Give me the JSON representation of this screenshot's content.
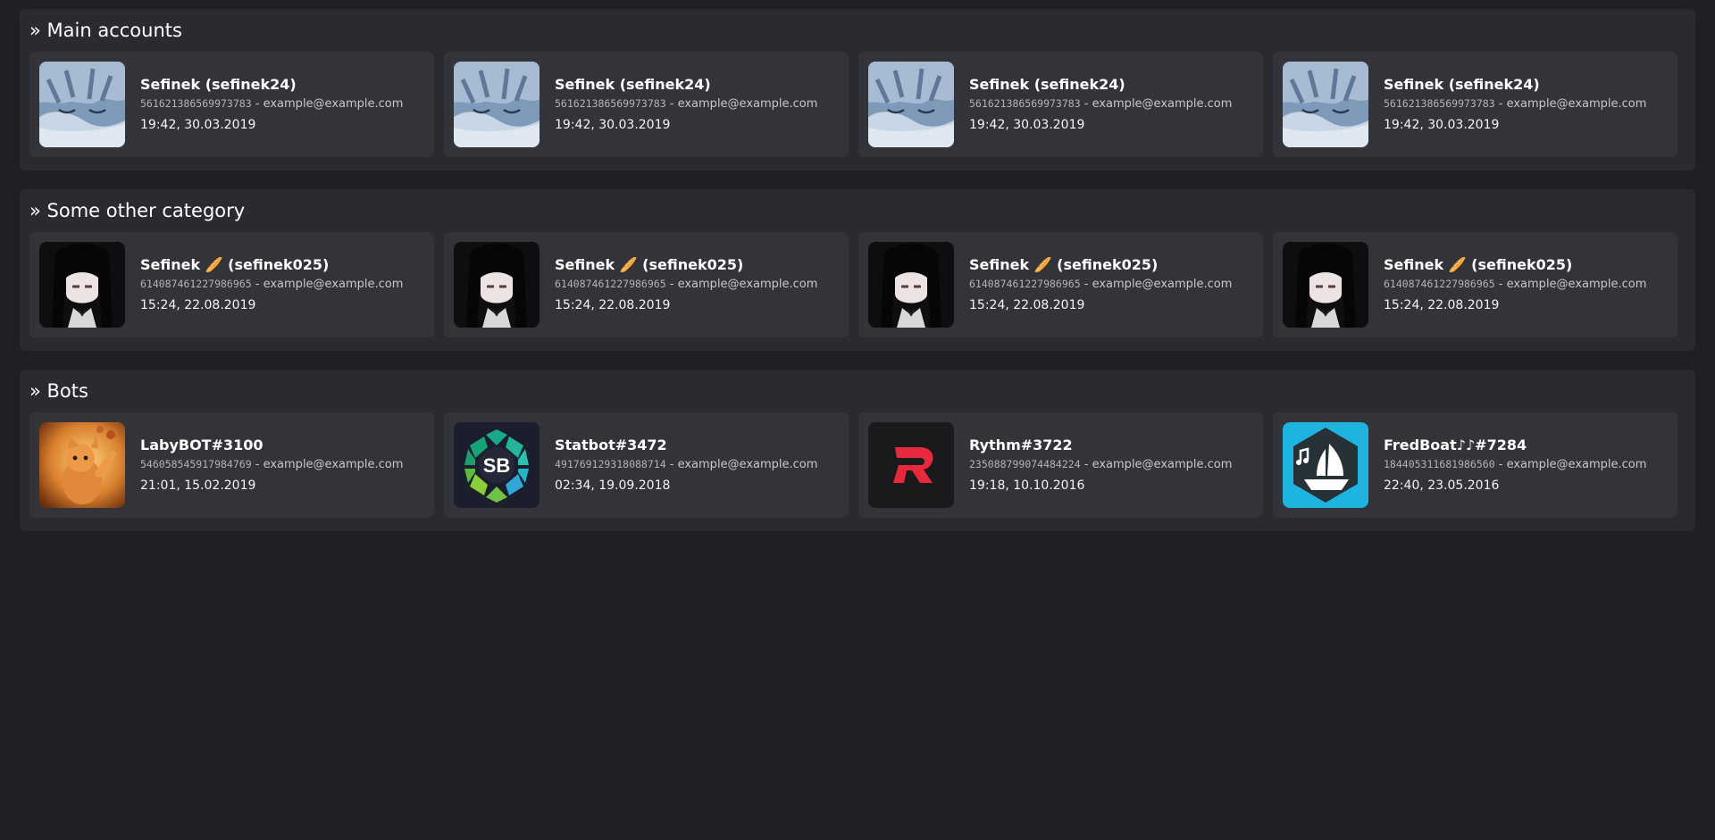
{
  "sections": [
    {
      "title": "» Main accounts",
      "cards": [
        {
          "name": "Sefinek (sefinek24)",
          "id": "561621386569973783",
          "email": "example@example.com",
          "date": "19:42, 30.03.2019",
          "avatar_icon": "anime-blue-hair-avatar"
        },
        {
          "name": "Sefinek (sefinek24)",
          "id": "561621386569973783",
          "email": "example@example.com",
          "date": "19:42, 30.03.2019",
          "avatar_icon": "anime-blue-hair-avatar"
        },
        {
          "name": "Sefinek (sefinek24)",
          "id": "561621386569973783",
          "email": "example@example.com",
          "date": "19:42, 30.03.2019",
          "avatar_icon": "anime-blue-hair-avatar"
        },
        {
          "name": "Sefinek (sefinek24)",
          "id": "561621386569973783",
          "email": "example@example.com",
          "date": "19:42, 30.03.2019",
          "avatar_icon": "anime-blue-hair-avatar"
        }
      ]
    },
    {
      "title": "» Some other category",
      "cards": [
        {
          "name": "Sefinek 🥖 (sefinek025)",
          "id": "614087461227986965",
          "email": "example@example.com",
          "date": "15:24, 22.08.2019",
          "avatar_icon": "anime-black-hair-avatar"
        },
        {
          "name": "Sefinek 🥖 (sefinek025)",
          "id": "614087461227986965",
          "email": "example@example.com",
          "date": "15:24, 22.08.2019",
          "avatar_icon": "anime-black-hair-avatar"
        },
        {
          "name": "Sefinek 🥖 (sefinek025)",
          "id": "614087461227986965",
          "email": "example@example.com",
          "date": "15:24, 22.08.2019",
          "avatar_icon": "anime-black-hair-avatar"
        },
        {
          "name": "Sefinek 🥖 (sefinek025)",
          "id": "614087461227986965",
          "email": "example@example.com",
          "date": "15:24, 22.08.2019",
          "avatar_icon": "anime-black-hair-avatar"
        }
      ]
    },
    {
      "title": "» Bots",
      "cards": [
        {
          "name": "LabyBOT#3100",
          "id": "546058545917984769",
          "email": "example@example.com",
          "date": "21:01, 15.02.2019",
          "avatar_icon": "kitten-avatar"
        },
        {
          "name": "Statbot#3472",
          "id": "491769129318088714",
          "email": "example@example.com",
          "date": "02:34, 19.09.2018",
          "avatar_icon": "statbot-logo",
          "logo_text": "SB"
        },
        {
          "name": "Rythm#3722",
          "id": "235088799074484224",
          "email": "example@example.com",
          "date": "19:18, 10.10.2016",
          "avatar_icon": "rythm-logo"
        },
        {
          "name": "FredBoat♪♪#7284",
          "id": "184405311681986560",
          "email": "example@example.com",
          "date": "22:40, 23.05.2016",
          "avatar_icon": "fredboat-logo"
        }
      ]
    }
  ],
  "separator": " - ",
  "colors": {
    "page_bg": "#1f2024",
    "section_bg": "#2a2b30",
    "card_bg": "#333439",
    "rythm_red": "#e8283c",
    "fredboat_blue": "#1fb3e0"
  }
}
